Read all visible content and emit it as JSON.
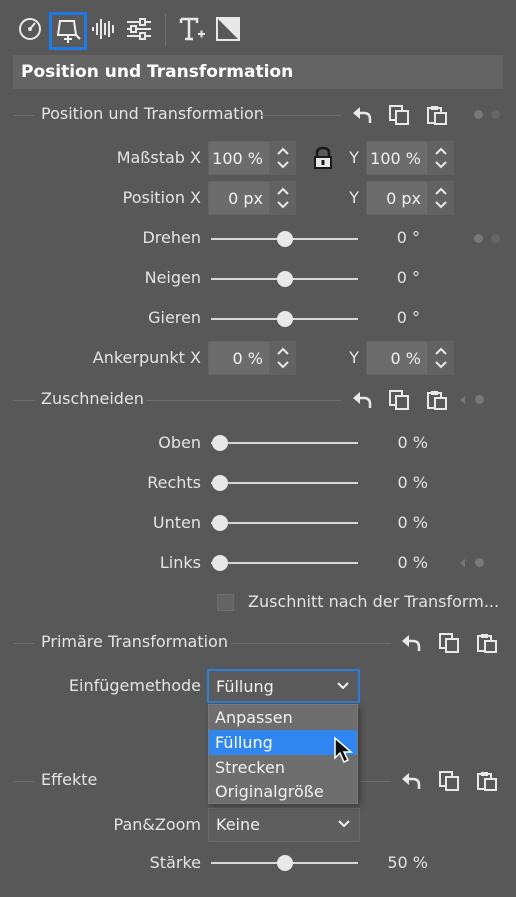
{
  "toolbar": {
    "icons": [
      "speedometer-icon",
      "transform-icon",
      "audio-waveform-icon",
      "sliders-icon",
      "text-add-icon",
      "mask-icon"
    ],
    "active": "transform-icon"
  },
  "panel_title": "Position und Transformation",
  "position_section": {
    "title": "Position und Transformation",
    "scale_x_label": "Maßstab X",
    "scale_x_value": "100 %",
    "scale_y_label": "Y",
    "scale_y_value": "100 %",
    "position_x_label": "Position X",
    "position_x_value": "0 px",
    "position_y_label": "Y",
    "position_y_value": "0 px",
    "rotate_label": "Drehen",
    "rotate_value": "0 °",
    "tilt_label": "Neigen",
    "tilt_value": "0 °",
    "yaw_label": "Gieren",
    "yaw_value": "0 °",
    "anchor_x_label": "Ankerpunkt X",
    "anchor_x_value": "0 %",
    "anchor_y_label": "Y",
    "anchor_y_value": "0 %",
    "slider_levels": {
      "rotate": 0.5,
      "tilt": 0.5,
      "yaw": 0.5
    }
  },
  "crop_section": {
    "title": "Zuschneiden",
    "top_label": "Oben",
    "top_value": "0 %",
    "right_label": "Rechts",
    "right_value": "0 %",
    "bottom_label": "Unten",
    "bottom_value": "0 %",
    "left_label": "Links",
    "left_value": "0 %",
    "crop_after_label": "Zuschnitt nach der Transform...",
    "crop_after_checked": false
  },
  "primary_section": {
    "title": "Primäre Transformation",
    "insert_method_label": "Einfügemethode",
    "insert_method_value": "Füllung",
    "dropdown_options": [
      "Anpassen",
      "Füllung",
      "Strecken",
      "Originalgröße"
    ],
    "highlighted_option": "Füllung"
  },
  "effects_section": {
    "title": "Effekte",
    "panzoom_label": "Pan&Zoom",
    "panzoom_value": "Keine",
    "strength_label": "Stärke",
    "strength_value": "50 %",
    "strength_level": 0.5
  },
  "colors": {
    "accent": "#1e7ae8",
    "highlight": "#2f86ee",
    "background": "#585858"
  }
}
